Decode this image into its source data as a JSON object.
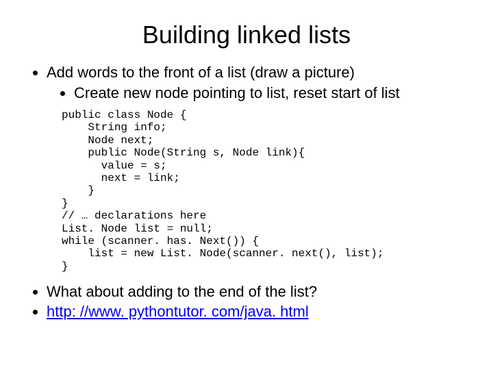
{
  "title": "Building linked lists",
  "bullet1": "Add words to the front of a list (draw a picture)",
  "bullet1a": "Create new node pointing to list, reset start of list",
  "code": "public class Node {\n    String info;\n    Node next;\n    public Node(String s, Node link){\n      value = s;\n      next = link;\n    }\n}\n// … declarations here\nList. Node list = null;\nwhile (scanner. has. Next()) {\n    list = new List. Node(scanner. next(), list);\n}",
  "bullet2": "What about adding to the end of the list?",
  "bullet3": "http: //www. pythontutor. com/java. html"
}
